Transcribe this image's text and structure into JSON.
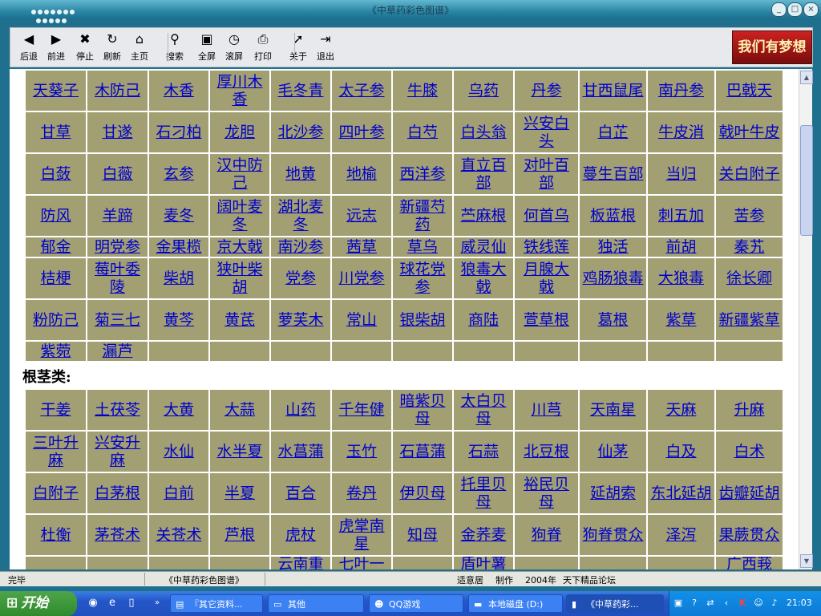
{
  "window": {
    "title": "《中草药彩色图谱》"
  },
  "toolbar": {
    "buttons": [
      {
        "label": "后退",
        "icon": "back-arrow-icon",
        "glyph": "◀"
      },
      {
        "label": "前进",
        "icon": "forward-arrow-icon",
        "glyph": "▶"
      },
      {
        "label": "停止",
        "icon": "stop-icon",
        "glyph": "✖"
      },
      {
        "label": "刷新",
        "icon": "refresh-icon",
        "glyph": "↻"
      },
      {
        "label": "主页",
        "icon": "home-icon",
        "glyph": "⌂"
      },
      {
        "label": "搜索",
        "icon": "search-icon",
        "glyph": "⚲"
      },
      {
        "label": "全屏",
        "icon": "fullscreen-icon",
        "glyph": "▣"
      },
      {
        "label": "滚屏",
        "icon": "scroll-icon",
        "glyph": "◷"
      },
      {
        "label": "打印",
        "icon": "printer-icon",
        "glyph": "⎙"
      },
      {
        "label": "关于",
        "icon": "about-cursor-icon",
        "glyph": "➚"
      },
      {
        "label": "退出",
        "icon": "exit-icon",
        "glyph": "⇥"
      }
    ],
    "banner": "我们有梦想"
  },
  "section1": {
    "rows": [
      [
        "天葵子",
        "木防己",
        "木香",
        "厚川木香",
        "毛冬青",
        "太子参",
        "牛膝",
        "乌药",
        "丹参",
        "甘西鼠尾",
        "南丹参",
        "巴戟天"
      ],
      [
        "甘草",
        "甘遂",
        "石刁柏",
        "龙胆",
        "北沙参",
        "四叶参",
        "白芍",
        "白头翁",
        "兴安白头",
        "白芷",
        "牛皮消",
        "戟叶牛皮"
      ],
      [
        "白蔹",
        "白薇",
        "玄参",
        "汉中防己",
        "地黄",
        "地榆",
        "西洋参",
        "直立百部",
        "对叶百部",
        "蔓生百部",
        "当归",
        "关白附子"
      ],
      [
        "防风",
        "羊蹄",
        "麦冬",
        "阔叶麦冬",
        "湖北麦冬",
        "远志",
        "新疆芍药",
        "苎麻根",
        "何首乌",
        "板蓝根",
        "刺五加",
        "苦参"
      ],
      [
        "郁金",
        "明党参",
        "金果榄",
        "京大戟",
        "南沙参",
        "茜草",
        "草乌",
        "威灵仙",
        "铁线莲",
        "独活",
        "前胡",
        "秦艽"
      ],
      [
        "桔梗",
        "莓叶委陵",
        "柴胡",
        "狭叶柴胡",
        "党参",
        "川党参",
        "球花党参",
        "狼毒大戟",
        "月腺大戟",
        "鸡肠狼毒",
        "大狼毒",
        "徐长卿"
      ],
      [
        "粉防己",
        "菊三七",
        "黄芩",
        "黄芪",
        "萝芙木",
        "常山",
        "银柴胡",
        "商陆",
        "萱草根",
        "葛根",
        "紫草",
        "新疆紫草"
      ],
      [
        "紫菀",
        "漏芦",
        "",
        "",
        "",
        "",
        "",
        "",
        "",
        "",
        "",
        ""
      ]
    ]
  },
  "section2": {
    "heading": "根茎类:",
    "rows": [
      [
        "干姜",
        "土茯苓",
        "大黄",
        "大蒜",
        "山药",
        "千年健",
        "暗紫贝母",
        "太白贝母",
        "川芎",
        "天南星",
        "天麻",
        "升麻"
      ],
      [
        "三叶升麻",
        "兴安升麻",
        "水仙",
        "水半夏",
        "水菖蒲",
        "玉竹",
        "石菖蒲",
        "石蒜",
        "北豆根",
        "仙茅",
        "白及",
        "白术"
      ],
      [
        "白附子",
        "白茅根",
        "白前",
        "半夏",
        "百合",
        "卷丹",
        "伊贝母",
        "托里贝母",
        "裕民贝母",
        "延胡索",
        "东北延胡",
        "齿瓣延胡"
      ],
      [
        "杜衡",
        "茅苍术",
        "关苍术",
        "芦根",
        "虎杖",
        "虎掌南星",
        "知母",
        "金荞麦",
        "狗脊",
        "狗脊贯众",
        "泽泻",
        "果蕨贯众"
      ],
      [
        "",
        "",
        "",
        "",
        "云南重",
        "七叶一",
        "",
        "盾叶薯",
        "",
        "",
        "",
        "广西莪"
      ]
    ]
  },
  "statusbar": {
    "left": "完毕",
    "center": "《中草药彩色图谱》",
    "maker": "适意居",
    "made": "制作",
    "year": "2004年",
    "forum": "天下精品论坛"
  },
  "taskbar": {
    "start_label": "开始",
    "tasks": [
      {
        "label": "『其它资料...",
        "icon": "folder-doc-icon",
        "glyph": "▤",
        "active": false
      },
      {
        "label": "其他",
        "icon": "folder-icon",
        "glyph": "▭",
        "active": false
      },
      {
        "label": "QQ游戏",
        "icon": "qq-game-icon",
        "glyph": "☻",
        "active": false
      },
      {
        "label": "本地磁盘 (D:)",
        "icon": "drive-icon",
        "glyph": "▬",
        "active": false
      },
      {
        "label": "《中草药彩...",
        "icon": "book-icon",
        "glyph": "▮",
        "active": true
      }
    ],
    "clock": "21:03"
  },
  "colors": {
    "cell_bg": "#a29f72",
    "link": "#0000cc"
  }
}
